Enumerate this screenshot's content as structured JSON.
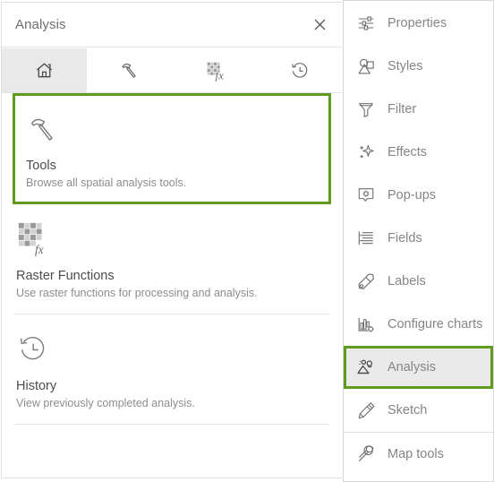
{
  "panel": {
    "title": "Analysis",
    "close_label": "Close",
    "close_icon": "close-icon",
    "tabs": [
      {
        "id": "home",
        "icon": "home-icon",
        "label": "Home",
        "active": true
      },
      {
        "id": "tools",
        "icon": "hammer-icon",
        "label": "Tools",
        "active": false
      },
      {
        "id": "raster",
        "icon": "raster-function-icon",
        "label": "Raster Functions",
        "active": false
      },
      {
        "id": "history",
        "icon": "history-icon",
        "label": "History",
        "active": false
      }
    ],
    "cards": [
      {
        "id": "tools",
        "icon": "hammer-icon",
        "title": "Tools",
        "description": "Browse all spatial analysis tools.",
        "highlighted": true
      },
      {
        "id": "raster-functions",
        "icon": "raster-function-icon",
        "title": "Raster Functions",
        "description": "Use raster functions for processing and analysis.",
        "highlighted": false
      },
      {
        "id": "history",
        "icon": "history-icon",
        "title": "History",
        "description": "View previously completed analysis.",
        "highlighted": false
      }
    ]
  },
  "sidebar": {
    "items": [
      {
        "id": "properties",
        "label": "Properties",
        "icon": "sliders-icon",
        "selected": false,
        "divider_above": false
      },
      {
        "id": "styles",
        "label": "Styles",
        "icon": "shapes-icon",
        "selected": false,
        "divider_above": false
      },
      {
        "id": "filter",
        "label": "Filter",
        "icon": "funnel-icon",
        "selected": false,
        "divider_above": false
      },
      {
        "id": "effects",
        "label": "Effects",
        "icon": "sparkle-icon",
        "selected": false,
        "divider_above": false
      },
      {
        "id": "pop-ups",
        "label": "Pop-ups",
        "icon": "popup-gear-icon",
        "selected": false,
        "divider_above": false
      },
      {
        "id": "fields",
        "label": "Fields",
        "icon": "fields-list-icon",
        "selected": false,
        "divider_above": false
      },
      {
        "id": "labels",
        "label": "Labels",
        "icon": "tag-icon",
        "selected": false,
        "divider_above": false
      },
      {
        "id": "configure-charts",
        "label": "Configure charts",
        "icon": "chart-gear-icon",
        "selected": false,
        "divider_above": false
      },
      {
        "id": "analysis",
        "label": "Analysis",
        "icon": "analysis-icon",
        "selected": true,
        "divider_above": false
      },
      {
        "id": "sketch",
        "label": "Sketch",
        "icon": "pencil-icon",
        "selected": false,
        "divider_above": false
      },
      {
        "id": "map-tools",
        "label": "Map tools",
        "icon": "wrench-icon",
        "selected": false,
        "divider_above": true
      }
    ]
  },
  "colors": {
    "highlight_green": "#5e9b1e",
    "selected_background": "#eaeaea",
    "text_primary": "#4c4c4c",
    "text_secondary": "#8d8d8d",
    "icon_stroke": "#6e6e6e"
  }
}
